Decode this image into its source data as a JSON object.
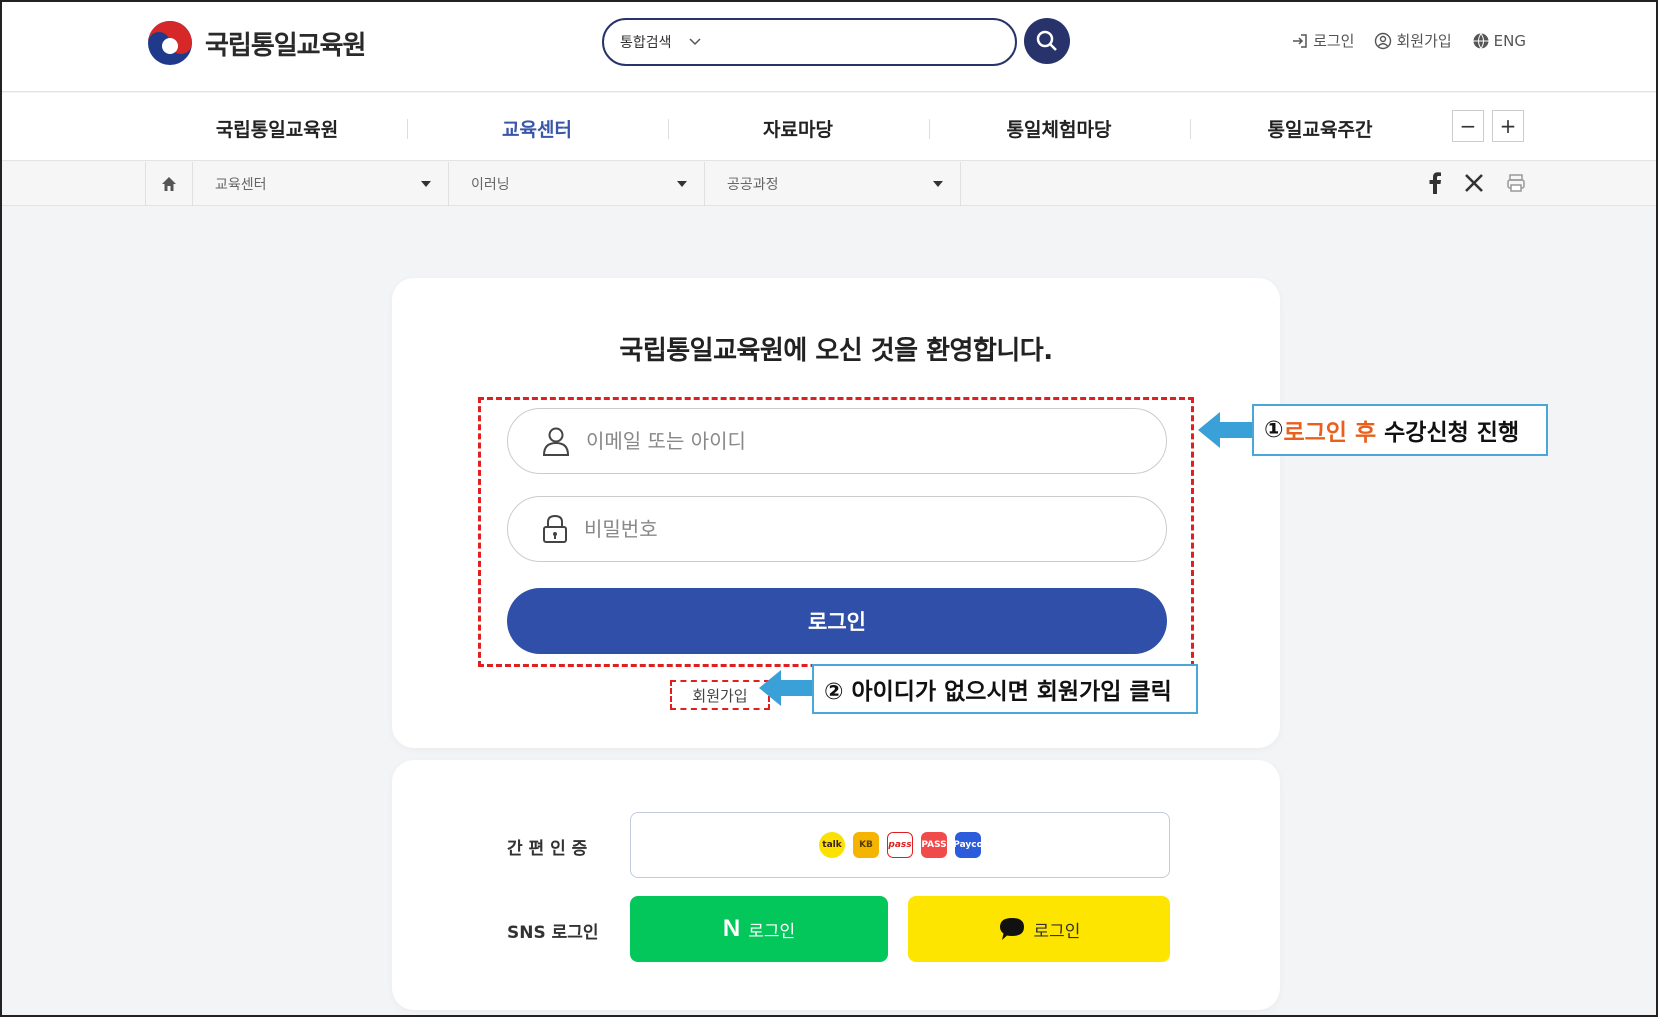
{
  "header": {
    "logo_text": "국립통일교육원",
    "search": {
      "category": "통합검색",
      "placeholder": ""
    },
    "util": {
      "login": "로그인",
      "join": "회원가입",
      "lang": "ENG"
    }
  },
  "gnb": {
    "items": [
      {
        "label": "국립통일교육원"
      },
      {
        "label": "교육센터"
      },
      {
        "label": "자료마당"
      },
      {
        "label": "통일체험마당"
      },
      {
        "label": "통일교육주간"
      }
    ],
    "active": "교육센터",
    "zoom_out": "−",
    "zoom_in": "+"
  },
  "location": {
    "level1": "교육센터",
    "level2": "이러닝",
    "level3": "공공과정"
  },
  "login": {
    "welcome": "국립통일교육원에 오신 것을 환영합니다.",
    "id_placeholder": "이메일 또는 아이디",
    "pw_placeholder": "비밀번호",
    "login_button": "로그인",
    "join_link": "회원가입"
  },
  "annotations": {
    "callout1_num": "①",
    "callout1_highlight": "로그인 후",
    "callout1_rest": " 수강신청 진행",
    "callout2": "② 아이디가 없으시면 회원가입 클릭"
  },
  "sns": {
    "easy_label": "간 편 인 증",
    "sns_label": "SNS 로그인",
    "naver_label": "로그인",
    "naver_mark": "N",
    "kakao_label": "로그인",
    "easy_icons": [
      "kakao-auth-icon",
      "kb-auth-icon",
      "pass-auth-icon",
      "toss-auth-icon",
      "payco-auth-icon"
    ],
    "easy_icon_text": [
      "talk",
      "KB",
      "pass",
      "PASS",
      "Payco"
    ]
  },
  "colors": {
    "primary": "#2f4fa9",
    "navy": "#27336a",
    "naver": "#03c75a",
    "kakao": "#fee500",
    "annotation_red": "#e02020",
    "annotation_blue": "#4aa7da",
    "highlight_orange": "#e8601c"
  }
}
